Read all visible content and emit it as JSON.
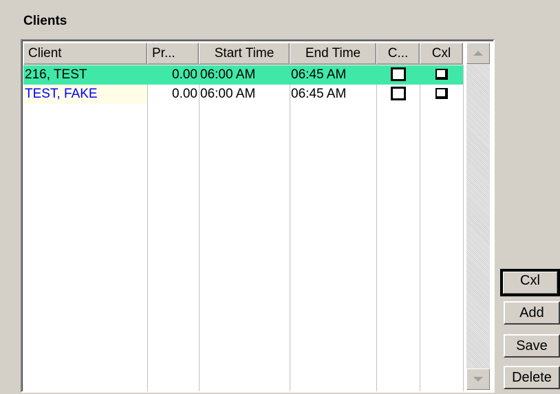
{
  "section_title": "Clients",
  "columns": [
    "Client",
    "Pr...",
    "Start Time",
    "End Time",
    "C...",
    "Cxl"
  ],
  "rows": [
    {
      "client": "216, TEST",
      "pr": "0.00",
      "start": "06:00 AM",
      "end": "06:45 AM",
      "c_checked": false,
      "cxl_checked": false
    },
    {
      "client": "TEST, FAKE",
      "pr": "0.00",
      "start": "06:00 AM",
      "end": "06:45 AM",
      "c_checked": false,
      "cxl_checked": false
    }
  ],
  "buttons": {
    "cxl": "Cxl",
    "add": "Add",
    "save": "Save",
    "delete": "Delete"
  },
  "colors": {
    "selected_row": "#40e8a8",
    "highlight_name_link": "#0000ff",
    "name_cell_bg": "#fffce8"
  }
}
